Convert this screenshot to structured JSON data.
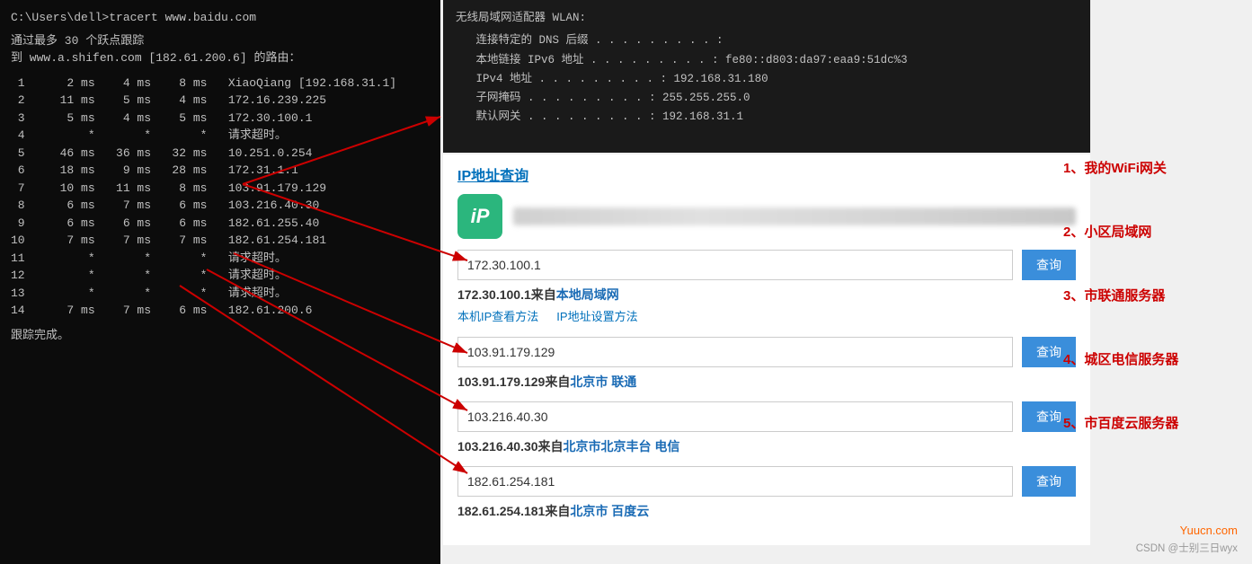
{
  "terminal": {
    "prompt": "C:\\Users\\dell>tracert www.baidu.com",
    "line1": "通过最多 30 个跃点跟踪",
    "line2": "到 www.a.shifen.com [182.61.200.6] 的路由：",
    "rows": [
      {
        "num": "1",
        "t1": "2 ms",
        "t2": "4 ms",
        "t3": "8 ms",
        "host": "XiaoQiang [192.168.31.1]"
      },
      {
        "num": "2",
        "t1": "11 ms",
        "t2": "5 ms",
        "t3": "4 ms",
        "host": "172.16.239.225"
      },
      {
        "num": "3",
        "t1": "5 ms",
        "t2": "4 ms",
        "t3": "5 ms",
        "host": "172.30.100.1"
      },
      {
        "num": "4",
        "t1": "*",
        "t2": "*",
        "t3": "*",
        "host": "请求超时。"
      },
      {
        "num": "5",
        "t1": "46 ms",
        "t2": "36 ms",
        "t3": "32 ms",
        "host": "10.251.0.254"
      },
      {
        "num": "6",
        "t1": "18 ms",
        "t2": "9 ms",
        "t3": "28 ms",
        "host": "172.31.1.1"
      },
      {
        "num": "7",
        "t1": "10 ms",
        "t2": "11 ms",
        "t3": "8 ms",
        "host": "103.91.179.129"
      },
      {
        "num": "8",
        "t1": "6 ms",
        "t2": "7 ms",
        "t3": "6 ms",
        "host": "103.216.40.30"
      },
      {
        "num": "9",
        "t1": "6 ms",
        "t2": "6 ms",
        "t3": "6 ms",
        "host": "182.61.255.40"
      },
      {
        "num": "10",
        "t1": "7 ms",
        "t2": "7 ms",
        "t3": "7 ms",
        "host": "182.61.254.181"
      },
      {
        "num": "11",
        "t1": "*",
        "t2": "*",
        "t3": "*",
        "host": "请求超时。"
      },
      {
        "num": "12",
        "t1": "*",
        "t2": "*",
        "t3": "*",
        "host": "请求超时。"
      },
      {
        "num": "13",
        "t1": "*",
        "t2": "*",
        "t3": "*",
        "host": "请求超时。"
      },
      {
        "num": "14",
        "t1": "7 ms",
        "t2": "7 ms",
        "t3": "6 ms",
        "host": "182.61.200.6"
      }
    ],
    "footer": "跟踪完成。"
  },
  "network_panel": {
    "title": "无线局域网适配器 WLAN:",
    "lines": [
      {
        "label": "   连接特定的 DNS 后缀",
        "value": ""
      },
      {
        "label": "   本地链接 IPv6 地址",
        "value": "fe80::d803:da97:eaa9:51dc%3"
      },
      {
        "label": "   IPv4 地址",
        "value": "192.168.31.180"
      },
      {
        "label": "   子网掩码",
        "value": "255.255.255.0"
      },
      {
        "label": "   默认网关",
        "value": "192.168.31.1"
      }
    ]
  },
  "ip_lookup": {
    "title": "IP地址查询",
    "logo_text": "iP",
    "entries": [
      {
        "ip": "172.30.100.1",
        "result_pre": "172.30.100.1来自",
        "result_link": "本地局域网",
        "result_suffix": "",
        "show_links": true
      },
      {
        "ip": "103.91.179.129",
        "result_pre": "103.91.179.129来自",
        "result_link": "北京市 联通",
        "result_suffix": "",
        "show_links": false
      },
      {
        "ip": "103.216.40.30",
        "result_pre": "103.216.40.30来自",
        "result_link": "北京市北京丰台 电信",
        "result_suffix": "",
        "show_links": false
      },
      {
        "ip": "182.61.254.181",
        "result_pre": "182.61.254.181来自",
        "result_link": "北京市 百度云",
        "result_suffix": "",
        "show_links": false
      }
    ],
    "link1": "本机IP查看方法",
    "link2": "IP地址设置方法",
    "btn_label": "查询"
  },
  "annotations": [
    "1、我的WiFi网关",
    "2、小区局域网",
    "3、市联通服务器",
    "4、城区电信服务器",
    "5、市百度云服务器"
  ],
  "watermark": "Yuucn.com",
  "credit": "CSDN @士别三日wyx"
}
